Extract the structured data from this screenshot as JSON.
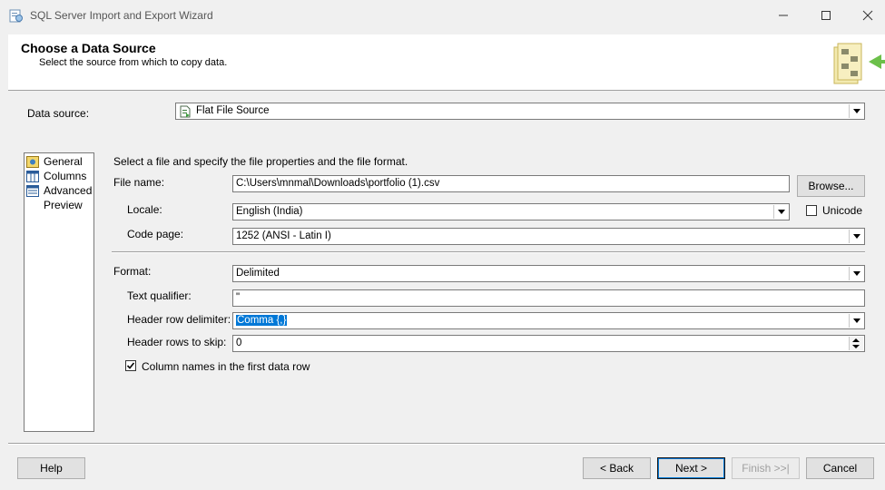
{
  "window": {
    "title": "SQL Server Import and Export Wizard"
  },
  "header": {
    "title": "Choose a Data Source",
    "subtitle": "Select the source from which to copy data."
  },
  "data_source": {
    "label": "Data source:",
    "value": "Flat File Source"
  },
  "nav": {
    "items": [
      {
        "label": "General"
      },
      {
        "label": "Columns"
      },
      {
        "label": "Advanced"
      },
      {
        "label": "Preview"
      }
    ]
  },
  "general": {
    "instructions": "Select a file and specify the file properties and the file format.",
    "file_name_label": "File name:",
    "file_name_value": "C:\\Users\\mnmal\\Downloads\\portfolio (1).csv",
    "browse_label": "Browse...",
    "locale_label": "Locale:",
    "locale_value": "English (India)",
    "unicode_label": "Unicode",
    "code_page_label": "Code page:",
    "code_page_value": "1252  (ANSI - Latin I)",
    "format_label": "Format:",
    "format_value": "Delimited",
    "text_qualifier_label": "Text qualifier:",
    "text_qualifier_value": "\"",
    "header_delim_label": "Header row delimiter:",
    "header_delim_value": "Comma {,}",
    "header_skip_label": "Header rows to skip:",
    "header_skip_value": "0",
    "column_names_label": "Column names in the first data row"
  },
  "footer": {
    "help": "Help",
    "back": "< Back",
    "next": "Next >",
    "finish": "Finish >>|",
    "cancel": "Cancel"
  }
}
